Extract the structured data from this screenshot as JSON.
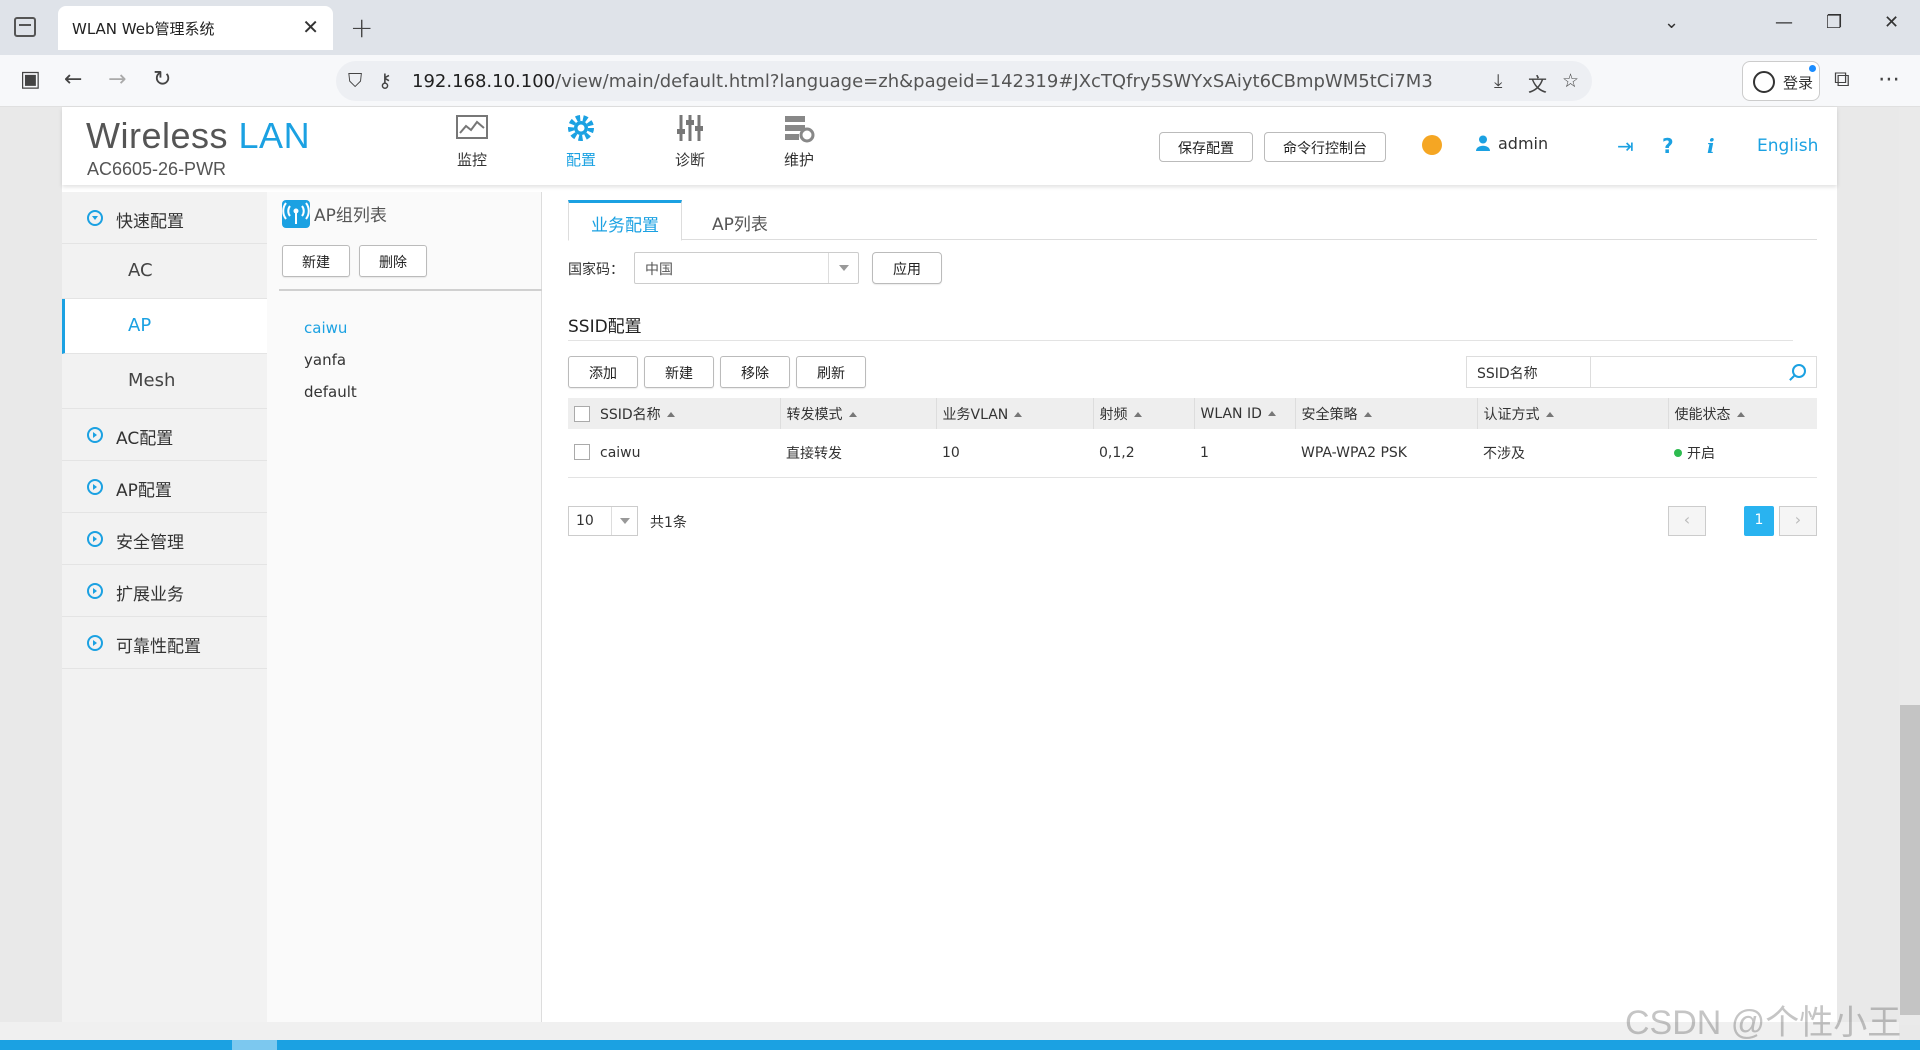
{
  "browser": {
    "tab_title": "WLAN Web管理系统",
    "url_host": "192.168.10.100",
    "url_path": "/view/main/default.html?language=zh&pageid=142319#JXcTQfry5SWYxSAiyt6CBmpWM5tCi7M3",
    "login_label": "登录"
  },
  "header": {
    "brand_wireless": "Wireless",
    "brand_lan": "LAN",
    "model": "AC6605-26-PWR",
    "nav": [
      {
        "label": "监控",
        "icon": "monitor-icon"
      },
      {
        "label": "配置",
        "icon": "gear-icon"
      },
      {
        "label": "诊断",
        "icon": "sliders-icon"
      },
      {
        "label": "维护",
        "icon": "maintain-icon"
      }
    ],
    "save_config": "保存配置",
    "cli_console": "命令行控制台",
    "user": "admin",
    "language": "English",
    "accent_color": "#1ba1e2"
  },
  "leftmenu": {
    "quick": "快速配置",
    "sub": [
      "AC",
      "AP",
      "Mesh"
    ],
    "items": [
      "AC配置",
      "AP配置",
      "安全管理",
      "扩展业务",
      "可靠性配置"
    ]
  },
  "apgroup": {
    "title": "AP组列表",
    "new_btn": "新建",
    "delete_btn": "删除",
    "groups": [
      "caiwu",
      "yanfa",
      "default"
    ]
  },
  "main": {
    "tabs": [
      "业务配置",
      "AP列表"
    ],
    "country_label": "国家码：",
    "country_value": "中国",
    "apply_btn": "应用",
    "section_title": "SSID配置",
    "toolbar": [
      "添加",
      "新建",
      "移除",
      "刷新"
    ],
    "search_label": "SSID名称",
    "columns": [
      "SSID名称",
      "转发模式",
      "业务VLAN",
      "射频",
      "WLAN ID",
      "安全策略",
      "认证方式",
      "使能状态"
    ],
    "rows": [
      [
        "caiwu",
        "直接转发",
        "10",
        "0,1,2",
        "1",
        "WPA-WPA2 PSK",
        "不涉及",
        "开启"
      ]
    ],
    "page_size": "10",
    "total": "共1条",
    "current_page": "1"
  },
  "watermark": "CSDN @个性小王"
}
